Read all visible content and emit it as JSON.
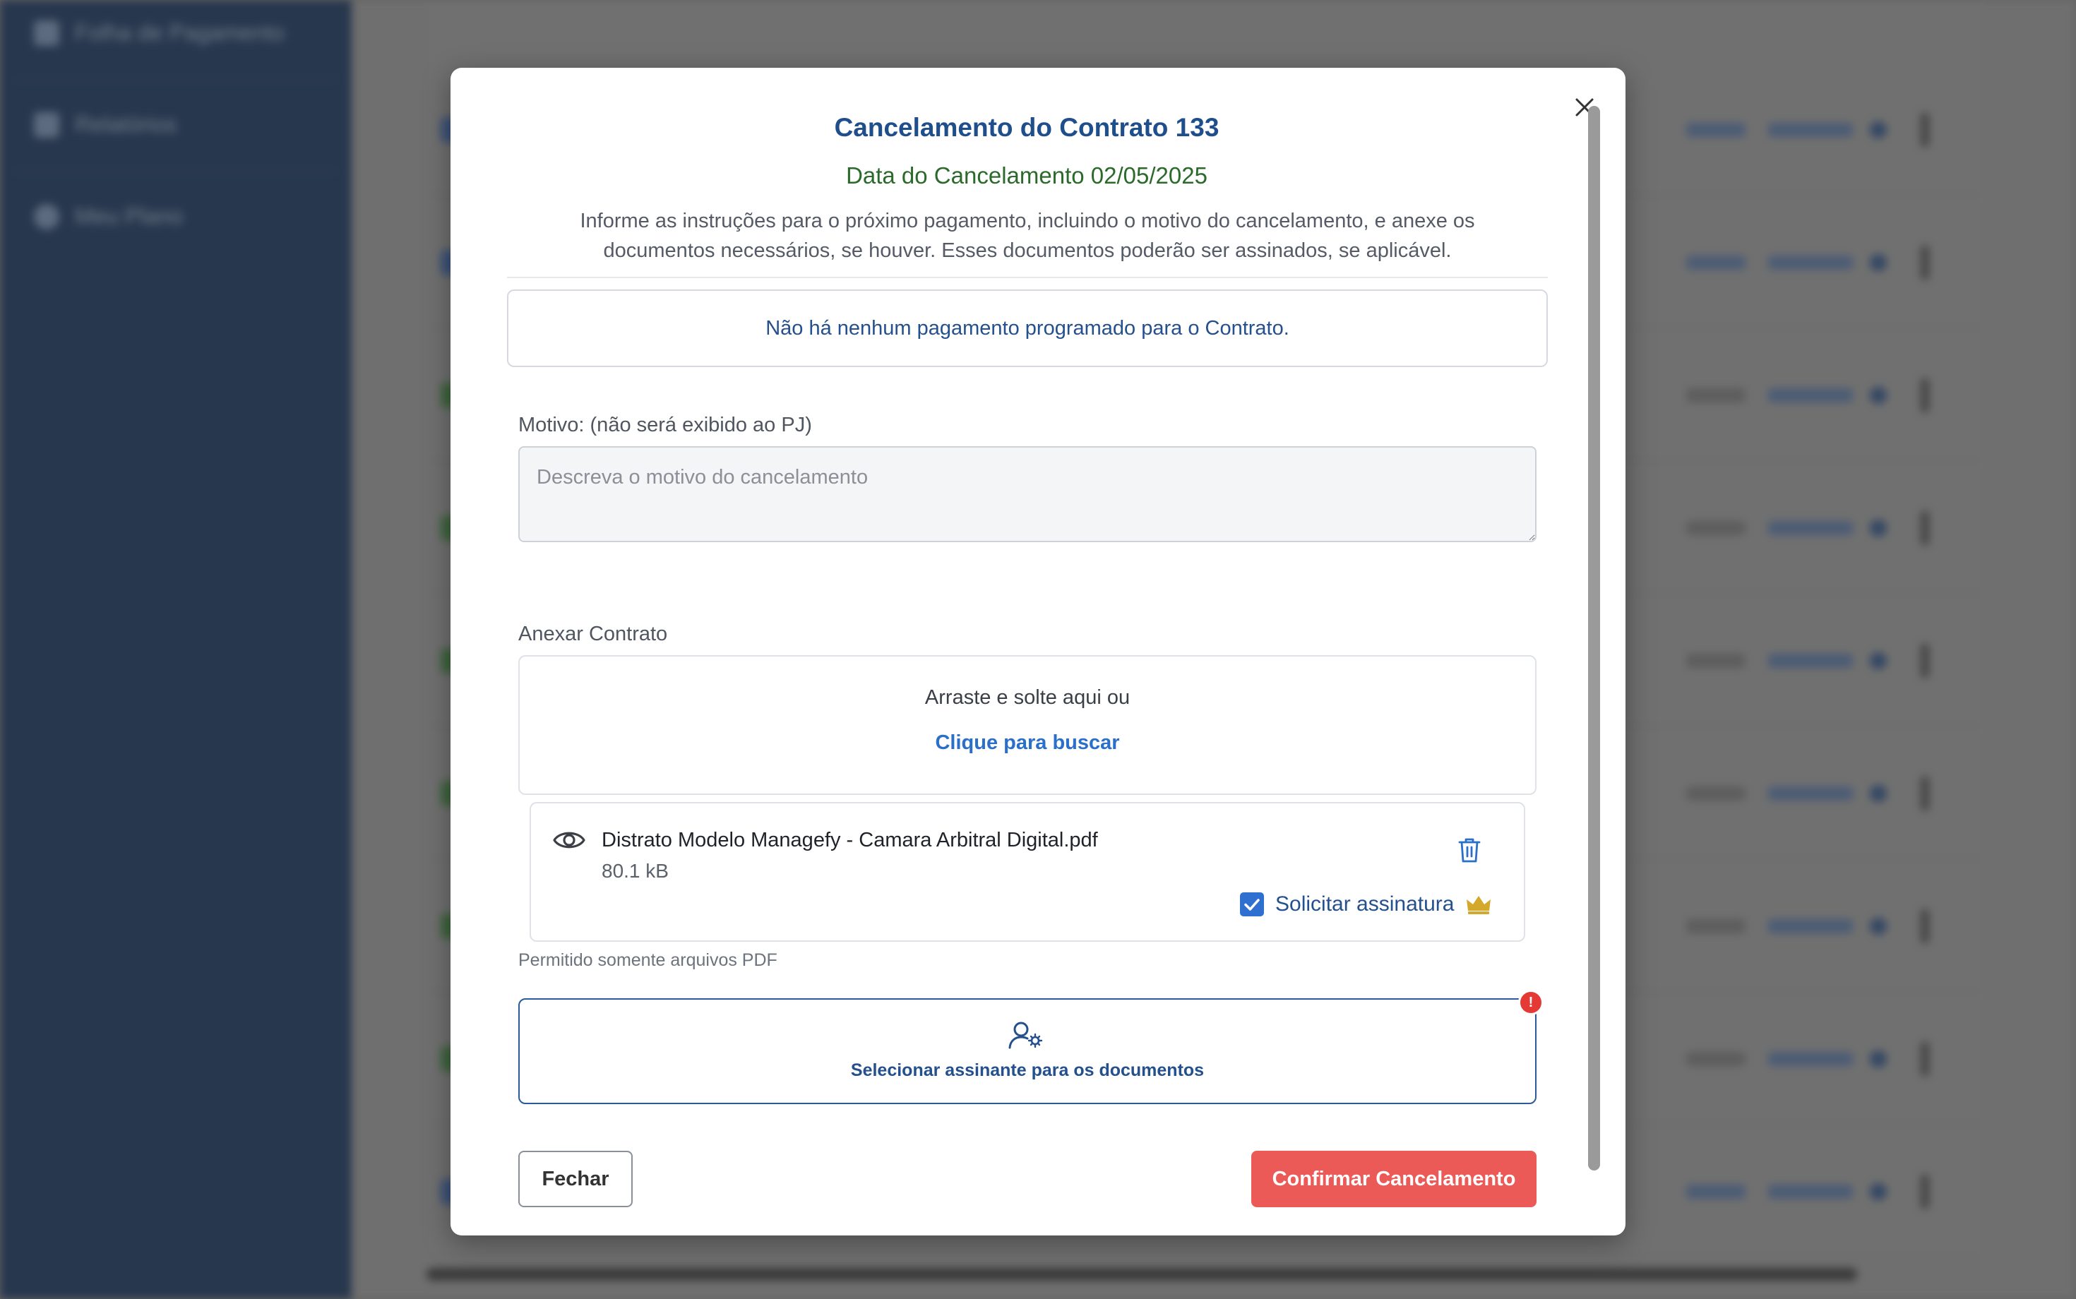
{
  "sidebar": {
    "items": [
      {
        "label": "Folha de Pagamento",
        "icon": "calendar-icon"
      },
      {
        "label": "Relatórios",
        "icon": "document-icon"
      },
      {
        "label": "Meu Plano",
        "icon": "star-icon"
      }
    ]
  },
  "modal": {
    "title": "Cancelamento do Contrato 133",
    "date_text": "Data do Cancelamento 02/05/2025",
    "instructions": "Informe as instruções para o próximo pagamento, incluindo o motivo do cancelamento, e anexe os documentos necessários, se houver. Esses documentos poderão ser assinados, se aplicável.",
    "no_payment_notice": "Não há nenhum pagamento programado para o Contrato.",
    "reason": {
      "label": "Motivo: (não será exibido ao PJ)",
      "placeholder": "Descreva o motivo do cancelamento",
      "value": ""
    },
    "attach": {
      "label": "Anexar Contrato",
      "drop_text": "Arraste e solte aqui ou",
      "browse_link": "Clique para buscar",
      "hint": "Permitido somente arquivos PDF"
    },
    "file": {
      "name": "Distrato Modelo Managefy - Camara Arbitral Digital.pdf",
      "size": "80.1 kB",
      "request_signature_label": "Solicitar assinatura",
      "request_signature_checked": true
    },
    "signer": {
      "label": "Selecionar assinante para os documentos",
      "alert_symbol": "!"
    },
    "buttons": {
      "close": "Fechar",
      "confirm": "Confirmar Cancelamento"
    }
  },
  "colors": {
    "primary_blue": "#1f4e8c",
    "success_green": "#2b6a2b",
    "link_blue": "#2a6fc9",
    "danger": "#ec5a58",
    "alert_red": "#e53935",
    "crown_gold": "#d4a82a",
    "sidebar_bg": "#1d3557"
  }
}
